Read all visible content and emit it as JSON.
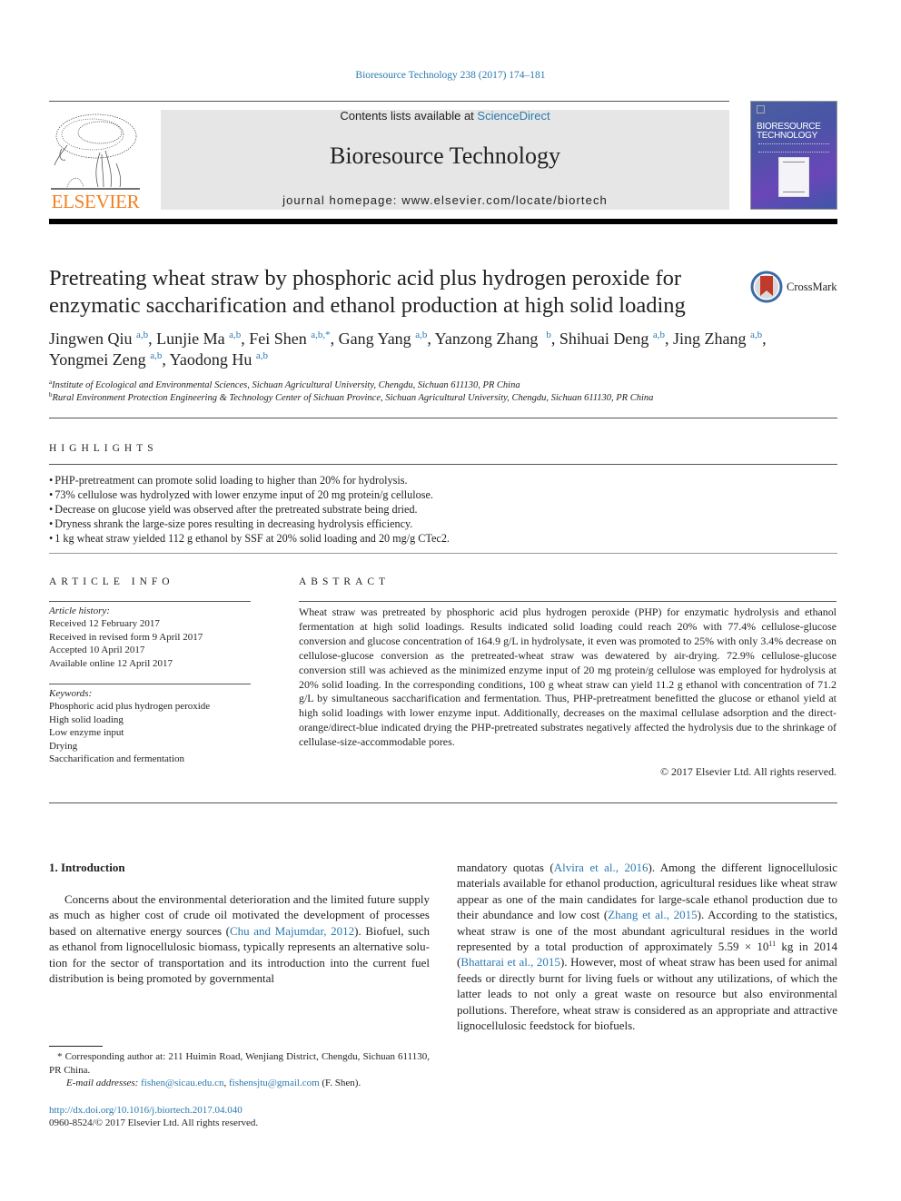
{
  "header": {
    "citation": "Bioresource Technology 238 (2017) 174–181",
    "contents_prefix": "Contents lists available at ",
    "contents_link": "ScienceDirect",
    "journal_name": "Bioresource Technology",
    "homepage": "journal homepage: www.elsevier.com/locate/biortech",
    "publisher_logo_text": "ELSEVIER",
    "cover_title_line1": "BIORESOURCE",
    "cover_title_line2": "TECHNOLOGY"
  },
  "article": {
    "title": "Pretreating wheat straw by phosphoric acid plus hydrogen peroxide for enzymatic saccharification and ethanol production at high solid loading",
    "crossmark_label": "CrossMark",
    "authors": [
      {
        "name": "Jingwen Qiu",
        "aff": "a,b"
      },
      {
        "name": "Lunjie Ma",
        "aff": "a,b"
      },
      {
        "name": "Fei Shen",
        "aff": "a,b,*"
      },
      {
        "name": "Gang Yang",
        "aff": "a,b"
      },
      {
        "name": "Yanzong Zhang",
        "aff": "b"
      },
      {
        "name": "Shihuai Deng",
        "aff": "a,b"
      },
      {
        "name": "Jing Zhang",
        "aff": "a,b"
      },
      {
        "name": "Yongmei Zeng",
        "aff": "a,b"
      },
      {
        "name": "Yaodong Hu",
        "aff": "a,b"
      }
    ],
    "affiliations": [
      {
        "mark": "a",
        "text": "Institute of Ecological and Environmental Sciences, Sichuan Agricultural University, Chengdu, Sichuan 611130, PR China"
      },
      {
        "mark": "b",
        "text": "Rural Environment Protection Engineering & Technology Center of Sichuan Province, Sichuan Agricultural University, Chengdu, Sichuan 611130, PR China"
      }
    ]
  },
  "highlights": {
    "heading": "HIGHLIGHTS",
    "items": [
      "PHP-pretreatment can promote solid loading to higher than 20% for hydrolysis.",
      "73% cellulose was hydrolyzed with lower enzyme input of 20 mg protein/g cellulose.",
      "Decrease on glucose yield was observed after the pretreated substrate being dried.",
      "Dryness shrank the large-size pores resulting in decreasing hydrolysis efficiency.",
      "1 kg wheat straw yielded 112 g ethanol by SSF at 20% solid loading and 20 mg/g CTec2."
    ]
  },
  "article_info": {
    "heading": "ARTICLE INFO",
    "history_label": "Article history:",
    "history": [
      "Received 12 February 2017",
      "Received in revised form 9 April 2017",
      "Accepted 10 April 2017",
      "Available online 12 April 2017"
    ],
    "keywords_label": "Keywords:",
    "keywords": [
      "Phosphoric acid plus hydrogen peroxide",
      "High solid loading",
      "Low enzyme input",
      "Drying",
      "Saccharification and fermentation"
    ]
  },
  "abstract": {
    "heading": "ABSTRACT",
    "text": "Wheat straw was pretreated by phosphoric acid plus hydrogen peroxide (PHP) for enzymatic hydrolysis and ethanol fermentation at high solid loadings. Results indicated solid loading could reach 20% with 77.4% cellulose-glucose conversion and glucose concentration of 164.9 g/L in hydrolysate, it even was promoted to 25% with only 3.4% decrease on cellulose-glucose conversion as the pretreated-wheat straw was dewatered by air-drying. 72.9% cellulose-glucose conversion still was achieved as the minimized enzyme input of 20 mg protein/g cellulose was employed for hydrolysis at 20% solid loading. In the cor­responding conditions, 100 g wheat straw can yield 11.2 g ethanol with concentration of 71.2 g/L by simultaneous saccharification and fermentation. Thus, PHP-pretreatment benefitted the glucose or etha­nol yield at high solid loadings with lower enzyme input. Additionally, decreases on the maximal cellu­lase adsorption and the direct-orange/direct-blue indicated drying the PHP-pretreated substrates negatively affected the hydrolysis due to the shrinkage of cellulase-size-accommodable pores.",
    "copyright": "© 2017 Elsevier Ltd. All rights reserved."
  },
  "introduction": {
    "heading": "1. Introduction",
    "left": {
      "p1": "Concerns about the environmental deterioration and the lim­ited future supply as much as higher cost of crude oil motivated the development of processes based on alternative energy sources (",
      "ref1": "Chu and Majumdar, 2012",
      "p2": "). Biofuel, such as ethanol from lignocellulosic biomass, typically represents an alternative solu­tion for the sector of transportation and its introduction into the current fuel distribution is being promoted by governmental"
    },
    "right": {
      "p1": "mandatory quotas (",
      "ref1": "Alvira et al., 2016",
      "p2": "). Among the different lignocellulosic materials available for ethanol production, agricultural residues like wheat straw appear as one of the main candidates for large-scale ethanol production due to their abundance and low cost (",
      "ref2": "Zhang et al., 2015",
      "p3": "). According to the statistics, wheat straw is one of the most abundant agricultural residues in the world represented by a total production of approximately 5.59 × 10",
      "exp": "11",
      "p4": " kg in 2014 (",
      "ref3": "Bhattarai et al., 2015",
      "p5": "). However, most of wheat straw has been used for animal feeds or directly burnt for living fuels or without any utilizations, of which the latter leads to not only a great waste on resource but also environmental pollutions. Therefore, wheat straw is considered as an appropriate and attractive lignocellulosic feed­stock for biofuels."
    }
  },
  "footnotes": {
    "corresponding": "* Corresponding author at: 211 Huimin Road, Wenjiang District, Chengdu, Sichuan 611130, PR China.",
    "email_label": "E-mail addresses: ",
    "email1": "fishen@sicau.edu.cn",
    "email_sep": ", ",
    "email2": "fishensjtu@gmail.com",
    "email_suffix": " (F. Shen).",
    "doi": "http://dx.doi.org/10.1016/j.biortech.2017.04.040",
    "issn": "0960-8524/© 2017 Elsevier Ltd. All rights reserved."
  }
}
